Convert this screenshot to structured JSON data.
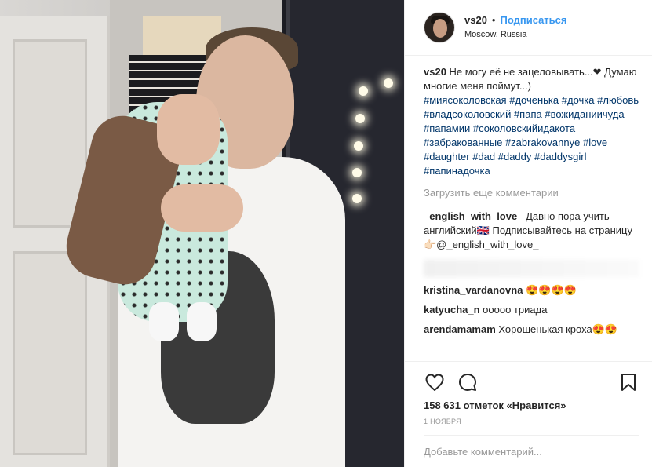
{
  "post": {
    "username": "vs20",
    "separator": "•",
    "follow_label": "Подписаться",
    "location": "Moscow, Russia",
    "caption": {
      "author": "vs20",
      "text": "Не могу её не зацеловывать...❤ Думаю многие меня поймут...)",
      "hashtags": [
        "#миясоколовская",
        "#доченька",
        "#дочка",
        "#любовь",
        "#владсоколовский",
        "#папа",
        "#вожиданиичуда",
        "#папамии",
        "#соколовскийидакота",
        "#забракованные",
        "#zabrakovannye",
        "#love",
        "#daughter",
        "#dad",
        "#daddy",
        "#daddysgirl",
        "#папинадочка"
      ]
    },
    "load_more_label": "Загрузить еще комментарии",
    "comments": [
      {
        "author": "_english_with_love_",
        "text": "Давно пора учить английский🇬🇧 Подписывайтесь на страницу 👉🏻@_english_with_love_"
      },
      {
        "author": "kristina_vardanovna",
        "text": "😍😍😍😍"
      },
      {
        "author": "katyucha_n",
        "text": "ооооо триада"
      },
      {
        "author": "arendamamam",
        "text": "Хорошенькая кроха😍😍"
      }
    ],
    "likes_label": "158 631 отметок «Нравится»",
    "date_label": "1 НОЯБРЯ",
    "add_comment_placeholder": "Добавьте комментарий..."
  },
  "icons": {
    "like": "heart-icon",
    "comment": "comment-bubble-icon",
    "save": "bookmark-icon"
  },
  "colors": {
    "link": "#3897f0",
    "hashtag": "#003569",
    "muted": "#999999"
  }
}
